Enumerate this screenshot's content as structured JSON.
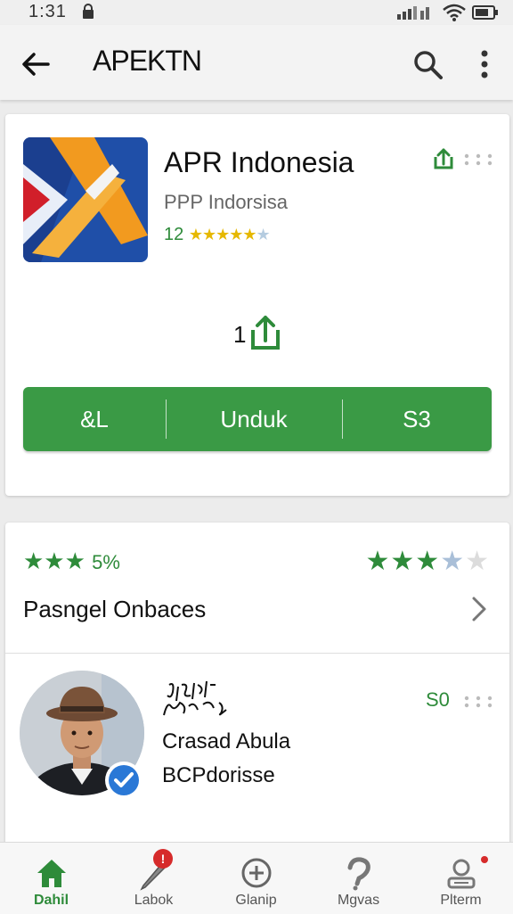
{
  "status_bar": {
    "time": "1:31"
  },
  "app_bar": {
    "title": "APEKTN"
  },
  "app": {
    "name": "APR Indonesia",
    "developer": "PPP Indorsisa",
    "rating_count": "12",
    "stars_text": "★★★★★",
    "share_count": "1"
  },
  "install_bar": {
    "left_label": "&L",
    "center_label": "Unduk",
    "right_label": "S3"
  },
  "ratings": {
    "left_stars": "★★★",
    "left_percent": "5%",
    "right_stars_full": "★★★",
    "right_star_half": "★",
    "right_star_empty": "★",
    "section_title": "Pasngel Onbaces"
  },
  "review": {
    "reviewer_name": "Crasad Abula",
    "reviewer_org": "BCPdorisse",
    "badge_text": "S0"
  },
  "bottom_nav": [
    {
      "label": "Dahil",
      "icon": "home-icon",
      "active": true
    },
    {
      "label": "Labok",
      "icon": "pen-icon",
      "badge": "!"
    },
    {
      "label": "Glanip",
      "icon": "add-circle-icon"
    },
    {
      "label": "Mgvas",
      "icon": "question-icon"
    },
    {
      "label": "Plterm",
      "icon": "profile-icon"
    }
  ],
  "colors": {
    "accent_green": "#3a9a45",
    "star_yellow": "#e6b800",
    "badge_red": "#d62b2b"
  }
}
